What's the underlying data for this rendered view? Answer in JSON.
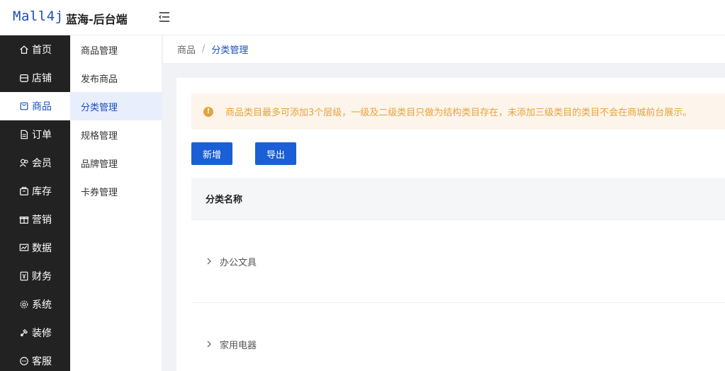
{
  "header": {
    "logo": "Mall4j",
    "shop_name": "蓝海-后台端"
  },
  "primary_nav": [
    {
      "label": "首页",
      "icon": "home-icon"
    },
    {
      "label": "店铺",
      "icon": "store-icon"
    },
    {
      "label": "商品",
      "icon": "product-icon",
      "active": true
    },
    {
      "label": "订单",
      "icon": "order-icon"
    },
    {
      "label": "会员",
      "icon": "member-icon"
    },
    {
      "label": "库存",
      "icon": "inventory-icon"
    },
    {
      "label": "营销",
      "icon": "gift-icon"
    },
    {
      "label": "数据",
      "icon": "chart-icon"
    },
    {
      "label": "财务",
      "icon": "finance-icon"
    },
    {
      "label": "系统",
      "icon": "gear-icon"
    },
    {
      "label": "装修",
      "icon": "brush-icon"
    },
    {
      "label": "客服",
      "icon": "chat-icon"
    }
  ],
  "secondary_nav": [
    {
      "label": "商品管理"
    },
    {
      "label": "发布商品"
    },
    {
      "label": "分类管理",
      "active": true
    },
    {
      "label": "规格管理"
    },
    {
      "label": "品牌管理"
    },
    {
      "label": "卡券管理"
    }
  ],
  "breadcrumb": {
    "parent": "商品",
    "separator": "/",
    "current": "分类管理"
  },
  "notice": {
    "text": "商品类目最多可添加3个层级，一级及二级类目只做为结构类目存在，未添加三级类目的类目不会在商城前台展示。"
  },
  "buttons": {
    "add": "新增",
    "export": "导出"
  },
  "table": {
    "header": "分类名称",
    "rows": [
      "办公文具",
      "家用电器"
    ]
  },
  "colors": {
    "primary": "#1a5fd6",
    "sidebar_bg": "#222222",
    "warning": "#e6a23c"
  }
}
